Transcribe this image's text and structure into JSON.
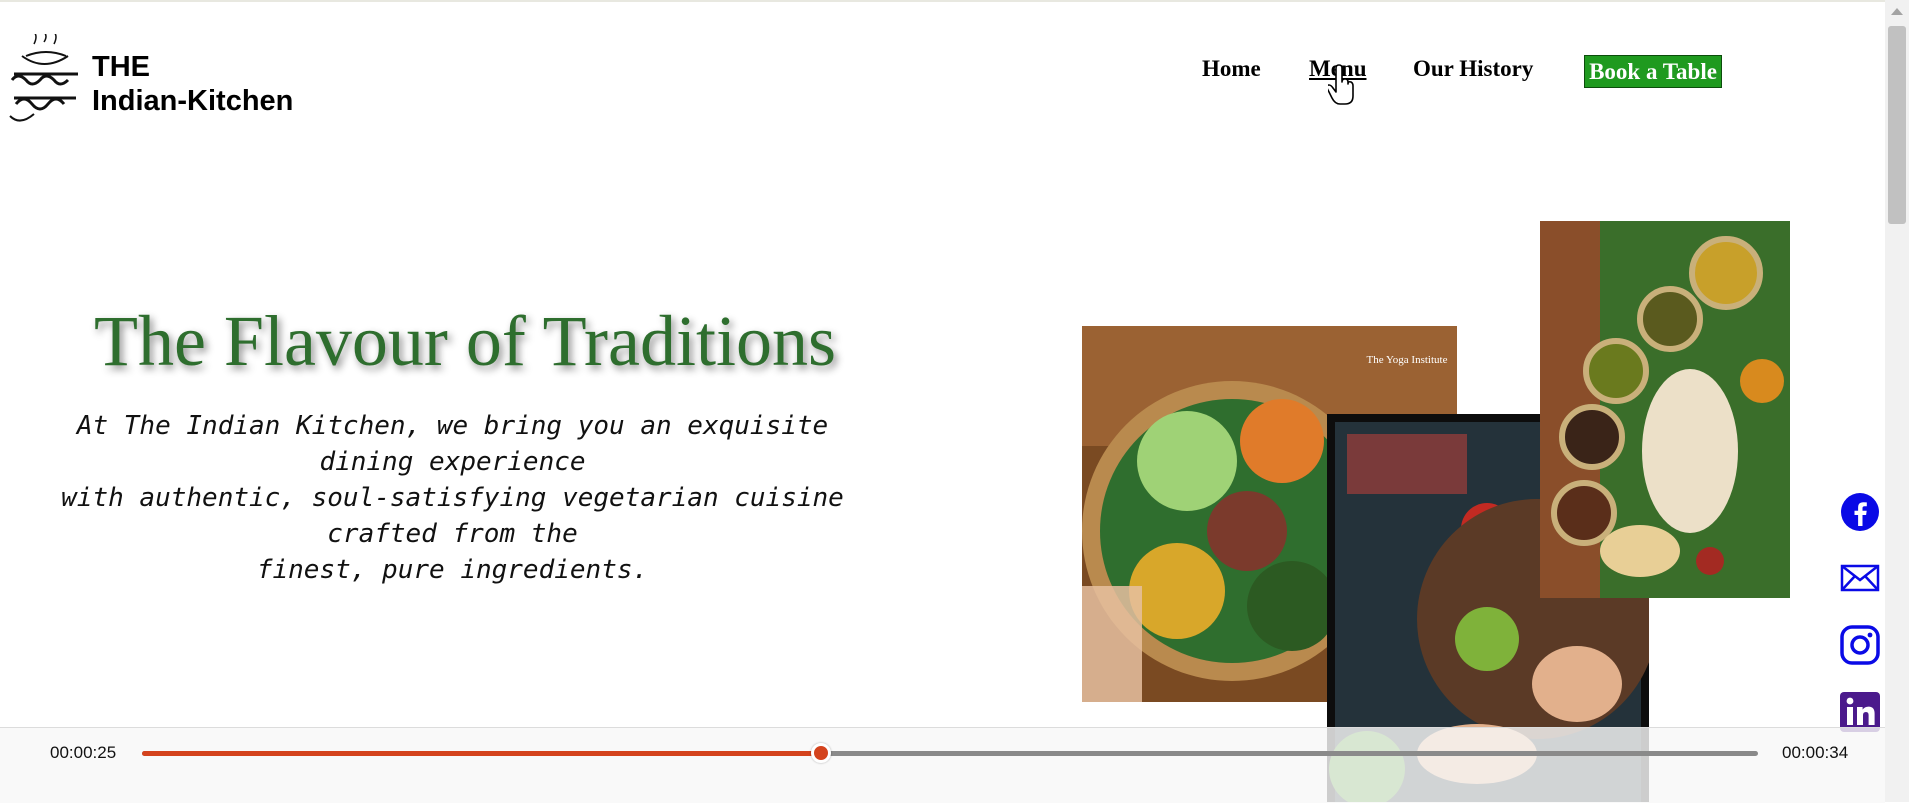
{
  "header": {
    "brand_line1": "THE",
    "brand_line2": "Indian-Kitchen",
    "nav": {
      "home": "Home",
      "menu": "Menu",
      "history": "Our History",
      "book": "Book a Table"
    }
  },
  "hero": {
    "title": "The Flavour of Traditions",
    "lines": [
      "At The Indian Kitchen, we bring you an exquisite",
      "dining experience",
      "with authentic, soul-satisfying vegetarian cuisine",
      "crafted from the",
      "finest, pure ingredients."
    ]
  },
  "images": {
    "photo1_caption": "The Yoga Institute"
  },
  "social": [
    "facebook-icon",
    "mail-icon",
    "instagram-icon",
    "linkedin-icon"
  ],
  "player": {
    "current_time": "00:00:25",
    "total_time": "00:00:34",
    "progress": 0.42
  },
  "colors": {
    "accent_green": "#2e6e2e",
    "button_green": "#1f9a1f",
    "progress_red": "#d4431d",
    "social_blue": "#0a0ae6",
    "linkedin_purple": "#4b1a8c"
  }
}
